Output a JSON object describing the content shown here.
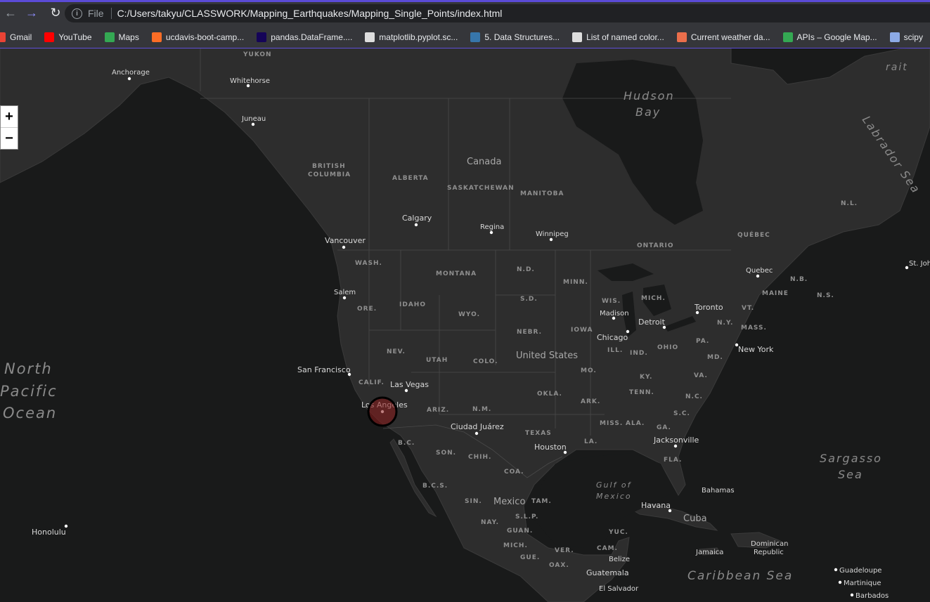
{
  "browser": {
    "file_label": "File",
    "url": "C:/Users/takyu/CLASSWORK/Mapping_Earthquakes/Mapping_Single_Points/index.html",
    "bookmarks": [
      {
        "label": "Gmail",
        "icon": "gmail-icon",
        "color": "#ea4335"
      },
      {
        "label": "YouTube",
        "icon": "youtube-icon",
        "color": "#ff0000"
      },
      {
        "label": "Maps",
        "icon": "maps-icon",
        "color": "#34a853"
      },
      {
        "label": "ucdavis-boot-camp...",
        "icon": "gitlab-icon",
        "color": "#fc6d26"
      },
      {
        "label": "pandas.DataFrame....",
        "icon": "pandas-icon",
        "color": "#150458"
      },
      {
        "label": "matplotlib.pyplot.sc...",
        "icon": "matplotlib-icon",
        "color": "#dddddd"
      },
      {
        "label": "5. Data Structures...",
        "icon": "python-icon",
        "color": "#3776ab"
      },
      {
        "label": "List of named color...",
        "icon": "matplotlib-icon",
        "color": "#dddddd"
      },
      {
        "label": "Current weather da...",
        "icon": "openweather-icon",
        "color": "#eb6e4b"
      },
      {
        "label": "APIs – Google Map...",
        "icon": "google-maps-icon",
        "color": "#34a853"
      },
      {
        "label": "scipy",
        "icon": "scipy-icon",
        "color": "#8caae6"
      }
    ]
  },
  "map": {
    "zoom_in": "+",
    "zoom_out": "−",
    "marker": {
      "city": "Los Angeles",
      "color": "#8b1a1a"
    },
    "labels": {
      "yukon": "YUKON",
      "anchorage": "Anchorage",
      "whitehorse": "Whitehorse",
      "juneau": "Juneau",
      "hudson1": "Hudson",
      "hudson2": "Bay",
      "labrador": "Labrador Sea",
      "strait": "rait",
      "canada": "Canada",
      "bc1": "BRITISH",
      "bc2": "COLUMBIA",
      "alberta": "ALBERTA",
      "sask": "SASKATCHEWAN",
      "manitoba": "MANITOBA",
      "nl": "N.L.",
      "quebec_prov": "QUÉBEC",
      "ontario": "ONTARIO",
      "calgary": "Calgary",
      "regina": "Regina",
      "winnipeg": "Winnipeg",
      "vancouver": "Vancouver",
      "wash": "WASH.",
      "montana": "MONTANA",
      "nd": "N.D.",
      "minn": "MINN.",
      "quebec": "Quebec",
      "stjohns": "St. Joh",
      "nb": "N.B.",
      "maine": "MAINE",
      "ns": "N.S.",
      "salem": "Salem",
      "ore": "ORE.",
      "idaho": "IDAHO",
      "wyo": "WYO.",
      "sd": "S.D.",
      "wis": "WIS.",
      "mich": "MICH.",
      "toronto": "Toronto",
      "vt": "VT.",
      "madison": "Madison",
      "detroit": "Detroit",
      "ny": "N.Y.",
      "mass": "MASS.",
      "nebr": "NEBR.",
      "iowa": "IOWA",
      "chicago": "Chicago",
      "ill": "ILL.",
      "ind": "IND.",
      "ohio": "OHIO",
      "pa": "PA.",
      "newyork": "New York",
      "north": "North",
      "pacific": "Pacific",
      "ocean": "Ocean",
      "nev": "NEV.",
      "utah": "UTAH",
      "colo": "COLO.",
      "us": "United States",
      "md": "MD.",
      "sf": "San Francisco",
      "calif": "CALIF.",
      "lasvegas": "Las Vegas",
      "mo": "MO.",
      "ky": "KY.",
      "va": "VA.",
      "la_city": "Los Angeles",
      "ariz": "ARIZ.",
      "nm": "N.M.",
      "okla": "OKLA.",
      "tenn": "TENN.",
      "nc": "N.C.",
      "ark": "ARK.",
      "sc": "S.C.",
      "ciudad": "Ciudad Juárez",
      "bc": "B.C.",
      "texas": "TEXAS",
      "miss": "MISS.",
      "ala": "ALA.",
      "ga": "GA.",
      "houston": "Houston",
      "la": "LA.",
      "jacksonville": "Jacksonville",
      "son": "SON.",
      "chih": "CHIH.",
      "fla": "FLA.",
      "sargasso1": "Sargasso",
      "sargasso2": "Sea",
      "coa": "COA.",
      "bcs": "B.C.S.",
      "gulf1": "Gulf of",
      "gulf2": "Mexico",
      "bahamas": "Bahamas",
      "sin": "SIN.",
      "mexico": "Mexico",
      "tam": "TAM.",
      "havana": "Havana",
      "cuba": "Cuba",
      "slp": "S.L.P.",
      "nay": "NAY.",
      "guan": "GUAN.",
      "yuc": "YUC.",
      "honolulu": "Honolulu",
      "mich_mx": "MICH.",
      "ver": "VER.",
      "cam": "CAM.",
      "jamaica": "Jamaica",
      "dr1": "Dominican",
      "dr2": "Republic",
      "gue": "GUE.",
      "oax": "OAX.",
      "belize": "Belize",
      "guadeloupe": "Guadeloupe",
      "guatemala": "Guatemala",
      "caribbean": "Caribbean Sea",
      "martinique": "Martinique",
      "elsalvador": "El Salvador",
      "barbados": "Barbados"
    }
  }
}
